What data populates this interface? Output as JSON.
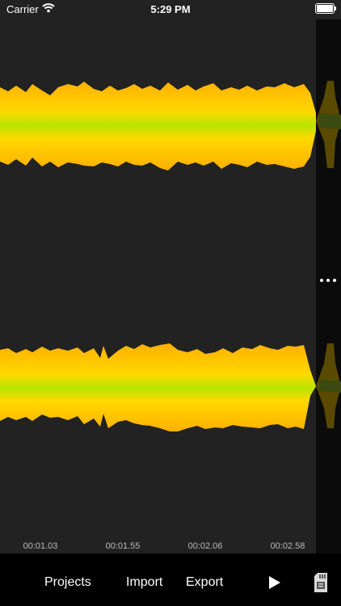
{
  "status": {
    "carrier": "Carrier",
    "time": "5:29 PM",
    "icons": [
      "wifi-icon",
      "battery-icon"
    ]
  },
  "waveform": {
    "colors": {
      "edge": "#FFB000",
      "mid": "#FFE600",
      "center": "#B7E600",
      "background": "#222222"
    },
    "channels": 2
  },
  "timeline": {
    "labels": [
      "00:01.03",
      "00:01.55",
      "00:02.06",
      "00:02.58"
    ]
  },
  "toolbar": {
    "projects_label": "Projects",
    "import_label": "Import",
    "export_label": "Export",
    "icons": [
      "play-icon",
      "sd-card-icon"
    ]
  },
  "side_panel": {
    "icon": "more-dots-icon"
  }
}
